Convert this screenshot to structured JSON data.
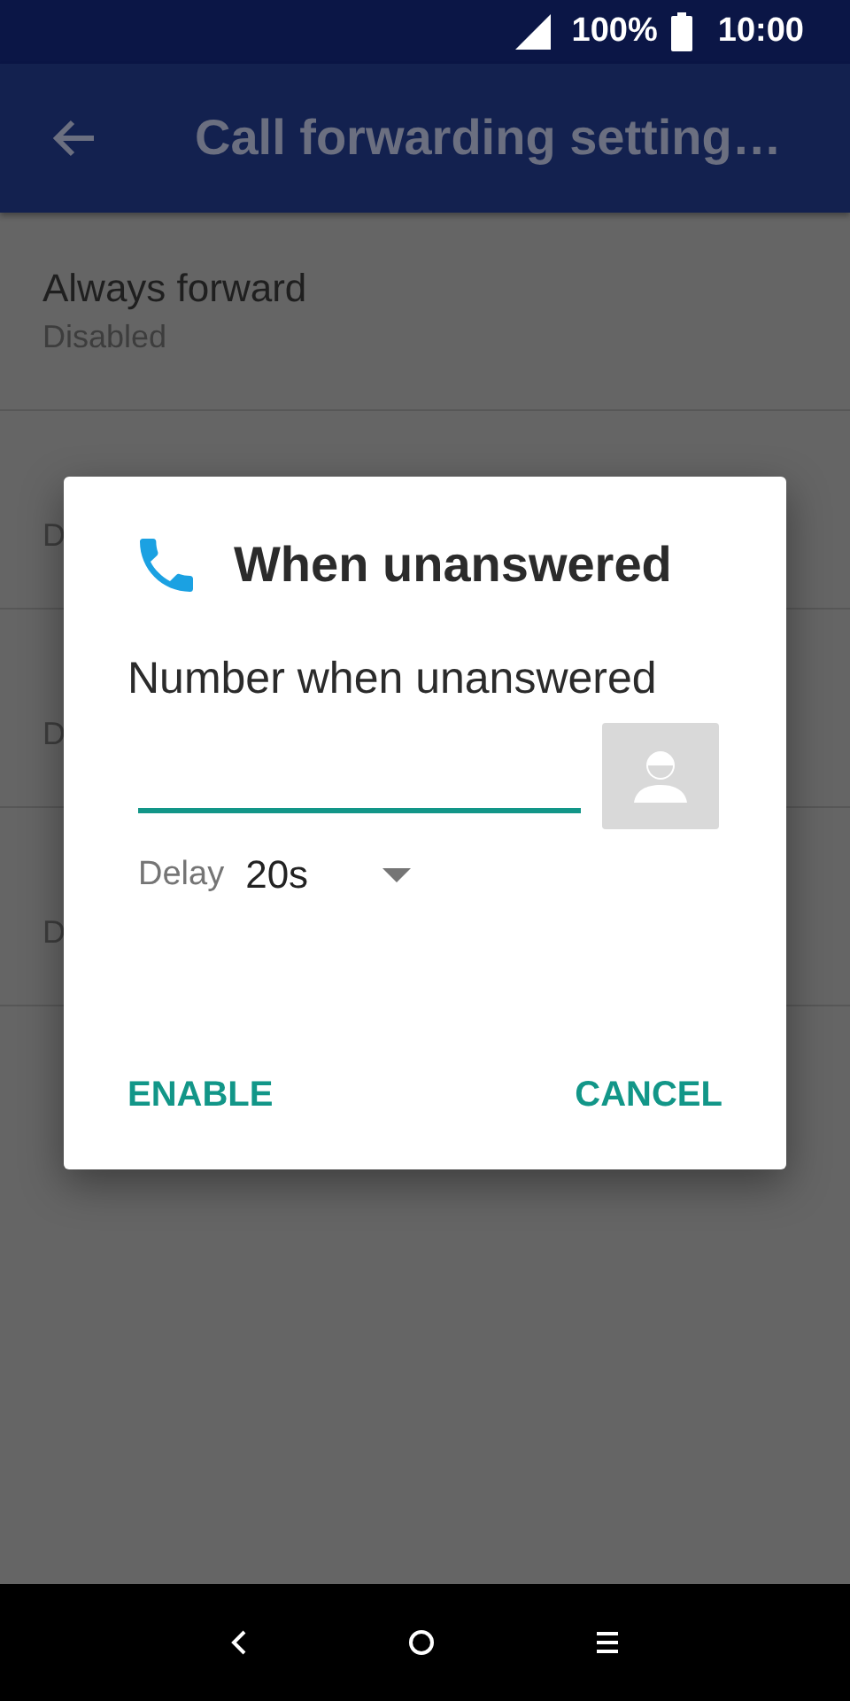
{
  "status_bar": {
    "battery": "100%",
    "time": "10:00"
  },
  "app_bar": {
    "title": "Call forwarding setting…"
  },
  "settings": [
    {
      "title": "Always forward",
      "subtitle": "Disabled"
    },
    {
      "subtitle": "D"
    },
    {
      "subtitle": "D"
    },
    {
      "subtitle": "D"
    }
  ],
  "dialog": {
    "title": "When unanswered",
    "field_label": "Number when unanswered",
    "delay_label": "Delay",
    "delay_value": "20s",
    "buttons": [
      "ENABLE",
      "CANCEL"
    ]
  }
}
